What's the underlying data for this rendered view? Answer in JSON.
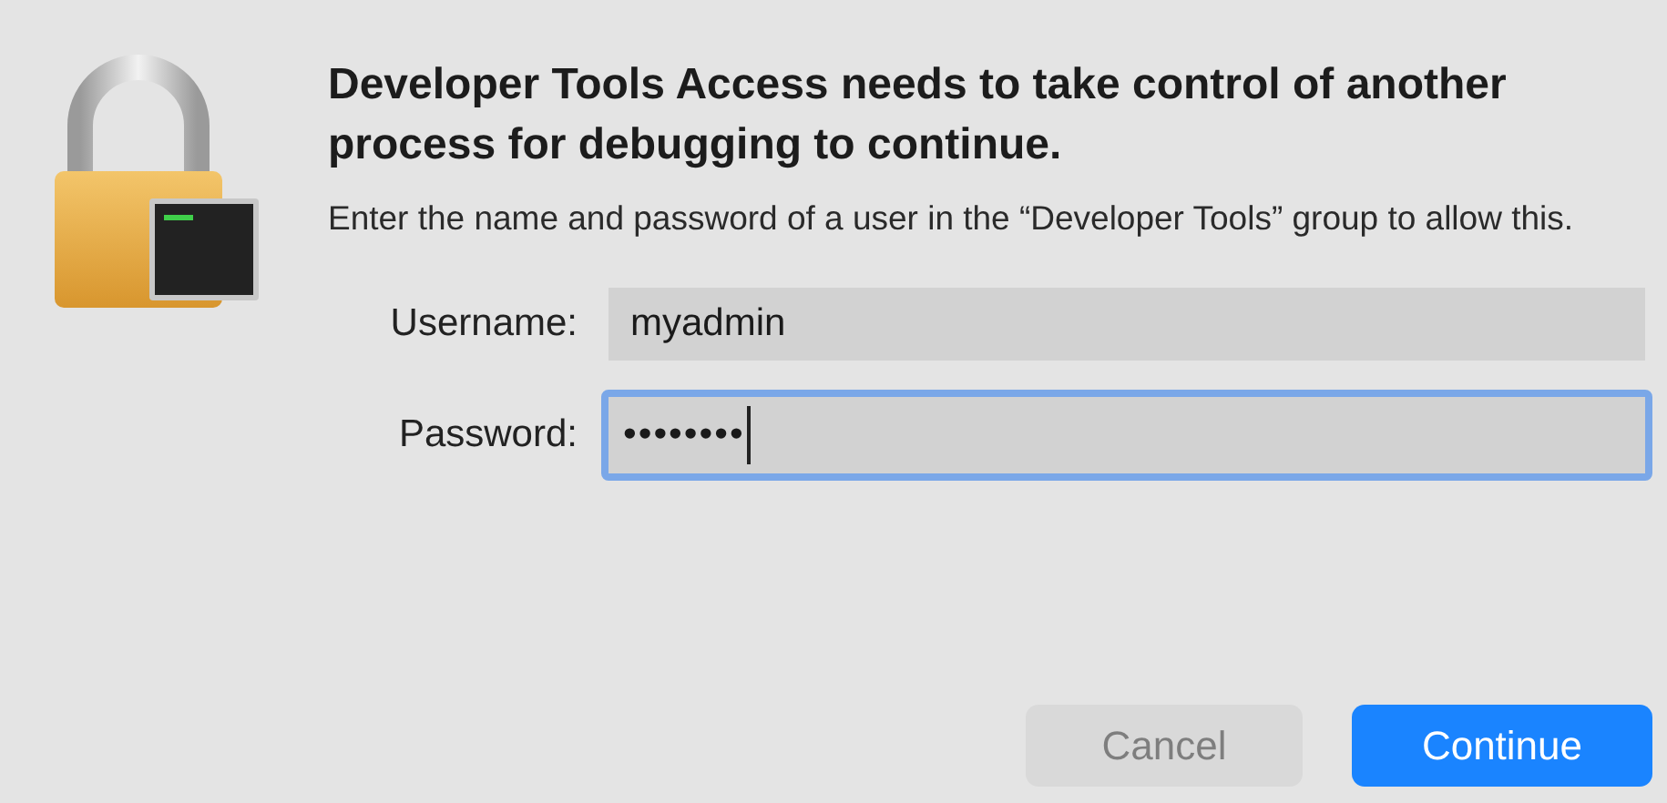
{
  "dialog": {
    "title": "Developer Tools Access needs to take control of another process for debugging to continue.",
    "message": "Enter the name and password of a user in the “Developer Tools” group to allow this.",
    "fields": [
      {
        "label": "Username:",
        "value": "myadmin",
        "focused": false
      },
      {
        "label": "Password:",
        "value": "••••••••",
        "focused": true
      }
    ],
    "buttons": [
      {
        "label": "Cancel",
        "kind": "secondary",
        "disabled": true
      },
      {
        "label": "Continue",
        "kind": "primary",
        "disabled": false
      }
    ]
  }
}
